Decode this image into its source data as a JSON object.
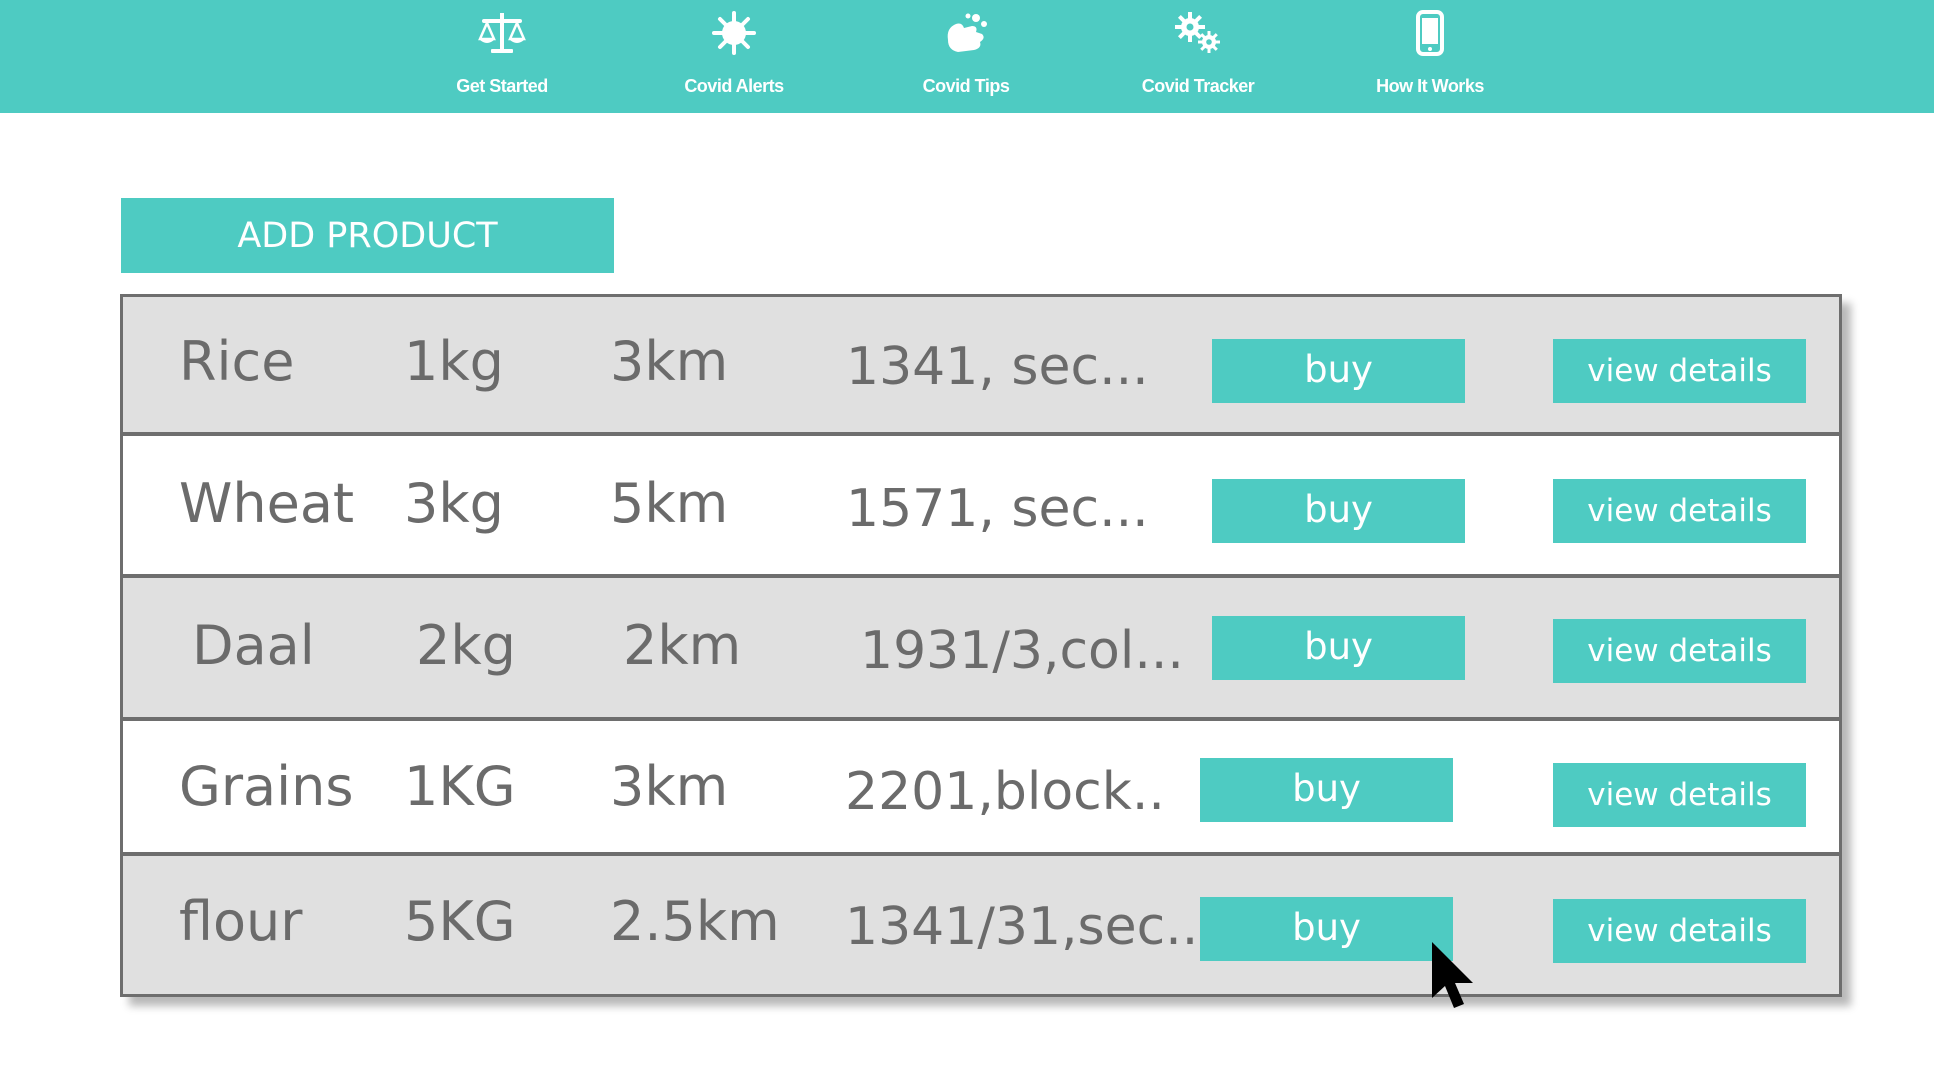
{
  "nav": {
    "items": [
      {
        "label": "Get Started",
        "icon": "scales-icon"
      },
      {
        "label": "Covid Alerts",
        "icon": "virus-icon"
      },
      {
        "label": "Covid Tips",
        "icon": "washing-hands-icon"
      },
      {
        "label": "Covid Tracker",
        "icon": "gears-icon"
      },
      {
        "label": "How It Works",
        "icon": "mobile-phone-icon"
      }
    ]
  },
  "add_product_label": "ADD PRODUCT",
  "products": [
    {
      "name": "Rice",
      "qty": "1kg",
      "distance": "3km",
      "address": "1341, sec...",
      "buy_label": "buy",
      "view_label": "view details"
    },
    {
      "name": "Wheat",
      "qty": "3kg",
      "distance": "5km",
      "address": "1571, sec...",
      "buy_label": "buy",
      "view_label": "view details"
    },
    {
      "name": "Daal",
      "qty": "2kg",
      "distance": "2km",
      "address": "1931/3,col...",
      "buy_label": "buy",
      "view_label": "view details"
    },
    {
      "name": "Grains",
      "qty": "1KG",
      "distance": "3km",
      "address": "2201,block..",
      "buy_label": "buy",
      "view_label": "view details"
    },
    {
      "name": "flour",
      "qty": "5KG",
      "distance": "2.5km",
      "address": "1341/31,sec..",
      "buy_label": "buy",
      "view_label": "view details"
    }
  ],
  "colors": {
    "accent": "#4ecbc2",
    "row_grey": "#e0e0e0",
    "text": "#6b6b6b"
  }
}
